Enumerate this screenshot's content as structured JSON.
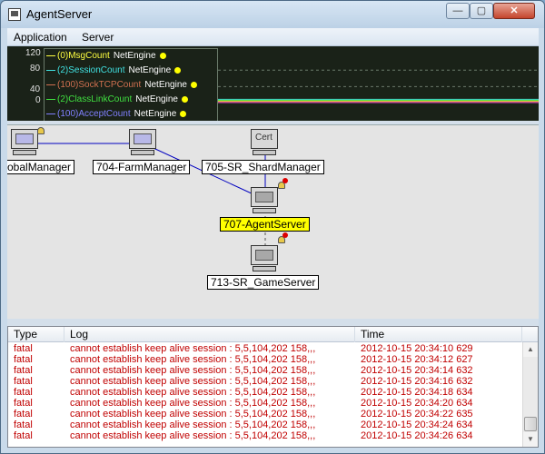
{
  "window": {
    "title": "AgentServer",
    "min_glyph": "—",
    "max_glyph": "▢",
    "close_glyph": "✕"
  },
  "menu": {
    "items": [
      "Application",
      "Server"
    ]
  },
  "chart_data": {
    "type": "line",
    "yticks": [
      "120",
      "80",
      "40",
      "0"
    ],
    "ylim": [
      0,
      120
    ],
    "series": [
      {
        "name": "(0)MsgCount",
        "source": "NetEngine",
        "color": "#ffff40",
        "values": [
          0
        ]
      },
      {
        "name": "(2)SessionCount",
        "source": "NetEngine",
        "color": "#40e0e0",
        "values": [
          5
        ]
      },
      {
        "name": "(100)SockTCPCount",
        "source": "NetEngine",
        "color": "#d07050",
        "values": [
          0
        ]
      },
      {
        "name": "(2)ClassLinkCount",
        "source": "NetEngine",
        "color": "#40e040",
        "values": [
          5
        ]
      },
      {
        "name": "(100)AcceptCount",
        "source": "NetEngine",
        "color": "#8080ff",
        "values": [
          0
        ]
      }
    ]
  },
  "graph": {
    "nodes": [
      {
        "label": "obalManager",
        "icon": "computer-icon"
      },
      {
        "label": "704-FarmManager",
        "icon": "computer-icon"
      },
      {
        "label": "705-SR_ShardManager",
        "icon": "cert-icon",
        "icon_text": "Cert"
      },
      {
        "label": "707-AgentServer",
        "icon": "computer-icon",
        "selected": true
      },
      {
        "label": "713-SR_GameServer",
        "icon": "computer-icon"
      }
    ],
    "selected_color": "#ffff00"
  },
  "log": {
    "columns": [
      "Type",
      "Log",
      "Time"
    ],
    "rows": [
      {
        "type": "fatal",
        "log": "cannot establish keep alive session : 5,5,104,202 158,,,",
        "time": "2012-10-15 20:34:10 629"
      },
      {
        "type": "fatal",
        "log": "cannot establish keep alive session : 5,5,104,202 158,,,",
        "time": "2012-10-15 20:34:12 627"
      },
      {
        "type": "fatal",
        "log": "cannot establish keep alive session : 5,5,104,202 158,,,",
        "time": "2012-10-15 20:34:14 632"
      },
      {
        "type": "fatal",
        "log": "cannot establish keep alive session : 5,5,104,202 158,,,",
        "time": "2012-10-15 20:34:16 632"
      },
      {
        "type": "fatal",
        "log": "cannot establish keep alive session : 5,5,104,202 158,,,",
        "time": "2012-10-15 20:34:18 634"
      },
      {
        "type": "fatal",
        "log": "cannot establish keep alive session : 5,5,104,202 158,,,",
        "time": "2012-10-15 20:34:20 634"
      },
      {
        "type": "fatal",
        "log": "cannot establish keep alive session : 5,5,104,202 158,,,",
        "time": "2012-10-15 20:34:22 635"
      },
      {
        "type": "fatal",
        "log": "cannot establish keep alive session : 5,5,104,202 158,,,",
        "time": "2012-10-15 20:34:24 634"
      },
      {
        "type": "fatal",
        "log": "cannot establish keep alive session : 5,5,104,202 158,,,",
        "time": "2012-10-15 20:34:26 634"
      }
    ],
    "text_color": "#c00000"
  }
}
